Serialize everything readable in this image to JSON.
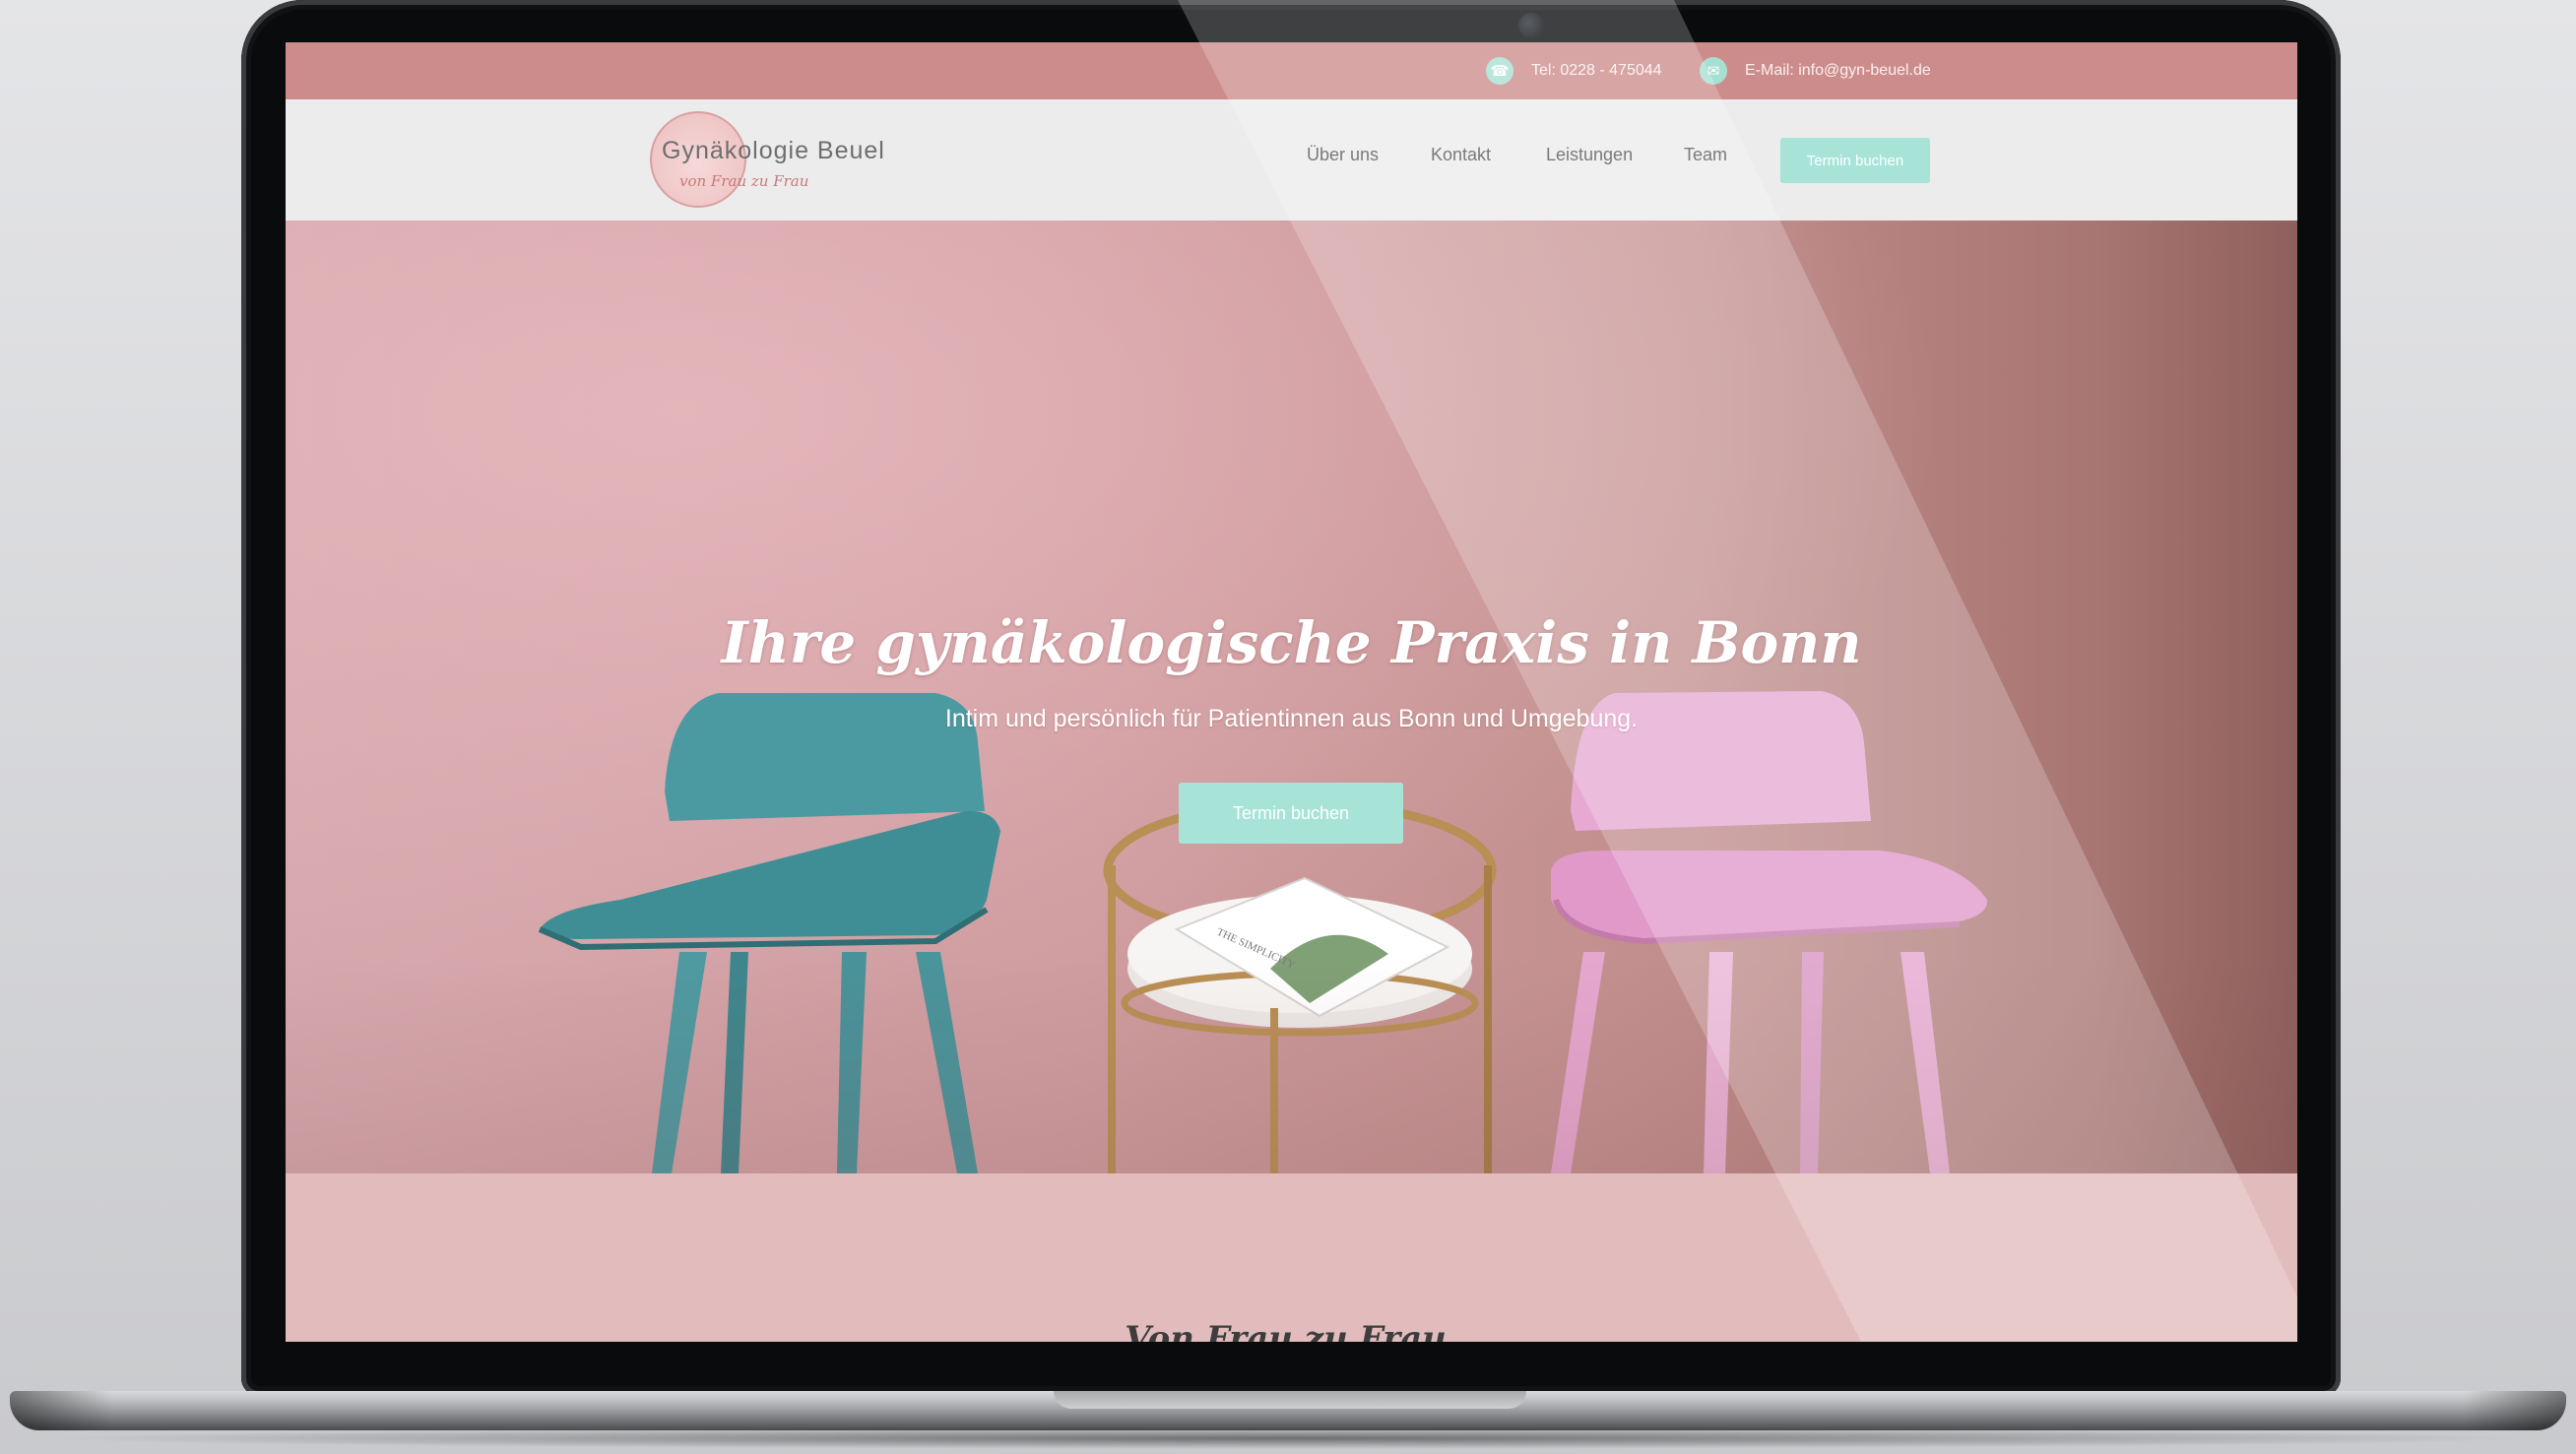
{
  "topbar": {
    "phone_icon": "phone-icon",
    "phone": "Tel: 0228 - 475044",
    "email_icon": "mail-icon",
    "email": "E-Mail: info@gyn-beuel.de"
  },
  "logo": {
    "title": "Gynäkologie Beuel",
    "tagline": "von Frau zu Frau"
  },
  "nav": {
    "items": [
      {
        "label": "Über uns"
      },
      {
        "label": "Kontakt"
      },
      {
        "label": "Leistungen"
      },
      {
        "label": "Team"
      }
    ],
    "cta": "Termin buchen"
  },
  "hero": {
    "title": "Ihre gynäkologische Praxis in Bonn",
    "subtitle": "Intim und persönlich für Patientinnen aus Bonn und Umgebung.",
    "cta": "Termin buchen",
    "magazine_text": "THE SIMPLICITY"
  },
  "intro": {
    "heading": "Von Frau zu Frau."
  },
  "colors": {
    "topbar": "#cd8c8c",
    "accent": "#a7e4d7",
    "navbar": "#ececec",
    "band": "#e2bcbc"
  }
}
